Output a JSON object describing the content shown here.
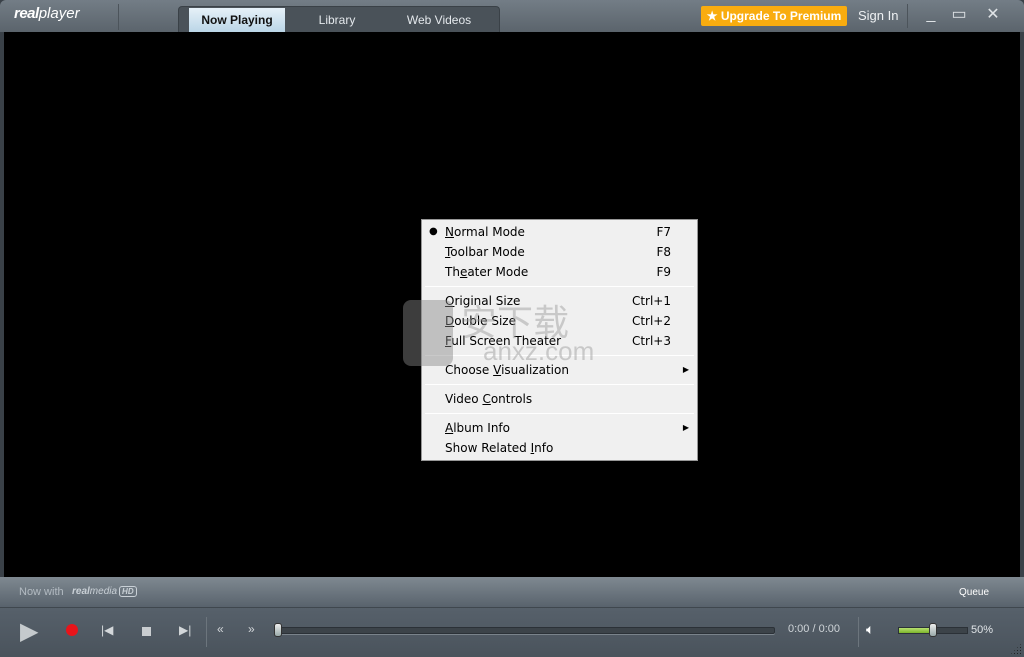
{
  "app": {
    "logo_text_bold": "real",
    "logo_text": "player"
  },
  "tabs": [
    {
      "label": "Now Playing",
      "active": true
    },
    {
      "label": "Library",
      "active": false
    },
    {
      "label": "Web Videos",
      "active": false
    }
  ],
  "header": {
    "upgrade_icon": "star-icon",
    "upgrade_label": "Upgrade To Premium",
    "signin_label": "Sign In",
    "accent": "#f9ac0f"
  },
  "window_controls": {
    "minimize": "_",
    "maximize": "▭",
    "close": "✕"
  },
  "context_menu": {
    "items": [
      {
        "before": "",
        "key": "N",
        "after": "ormal Mode",
        "shortcut": "F7",
        "checked": true
      },
      {
        "before": "",
        "key": "T",
        "after": "oolbar Mode",
        "shortcut": "F8"
      },
      {
        "before": "Th",
        "key": "e",
        "after": "ater Mode",
        "shortcut": "F9"
      },
      {
        "before": "",
        "key": "O",
        "after": "riginal Size",
        "shortcut": "Ctrl+1"
      },
      {
        "before": "",
        "key": "D",
        "after": "ouble Size",
        "shortcut": "Ctrl+2"
      },
      {
        "before": "",
        "key": "F",
        "after": "ull Screen Theater",
        "shortcut": "Ctrl+3"
      },
      {
        "before": "Choose ",
        "key": "V",
        "after": "isualization",
        "submenu": true
      },
      {
        "before": "Video ",
        "key": "C",
        "after": "ontrols"
      },
      {
        "before": "",
        "key": "A",
        "after": "lbum Info",
        "submenu": true
      },
      {
        "before": "Show Related ",
        "key": "I",
        "after": "nfo"
      }
    ]
  },
  "watermark": {
    "text": "安下载",
    "domain": "anxz.com"
  },
  "bottom": {
    "now_with": "Now with",
    "realmedia_bold": "real",
    "realmedia": "media",
    "hd": "HD",
    "queue_label": "Queue",
    "time": "0:00 / 0:00",
    "volume_percent_label": "50%",
    "volume": 0.5,
    "progress": 0
  }
}
